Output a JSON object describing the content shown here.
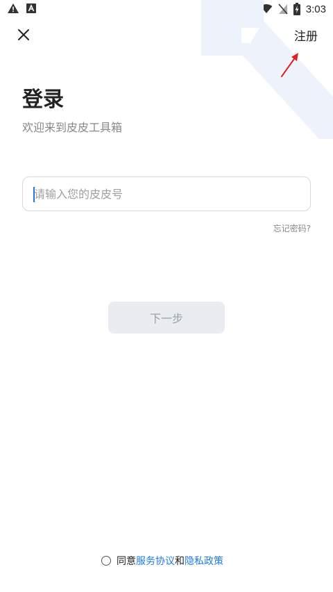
{
  "status_bar": {
    "time": "3:03",
    "icons": [
      "warning-icon",
      "a-text-icon",
      "wifi-icon",
      "no-sim-icon",
      "battery-charging-icon"
    ]
  },
  "header": {
    "close_icon": "close-icon",
    "register_label": "注册"
  },
  "login": {
    "title": "登录",
    "subtitle": "欢迎来到皮皮工具箱",
    "input_placeholder": "请输入您的皮皮号",
    "input_value": "",
    "forgot_label": "忘记密码?",
    "next_label": "下一步"
  },
  "agreement": {
    "prefix": "同意",
    "service_link": "服务协议",
    "conjunction": "和",
    "privacy_link": "隐私政策"
  },
  "colors": {
    "accent": "#1e7be6",
    "button_bg": "#e9edf2",
    "annotation_arrow": "#e02020",
    "watermark": "#eef3fb"
  }
}
